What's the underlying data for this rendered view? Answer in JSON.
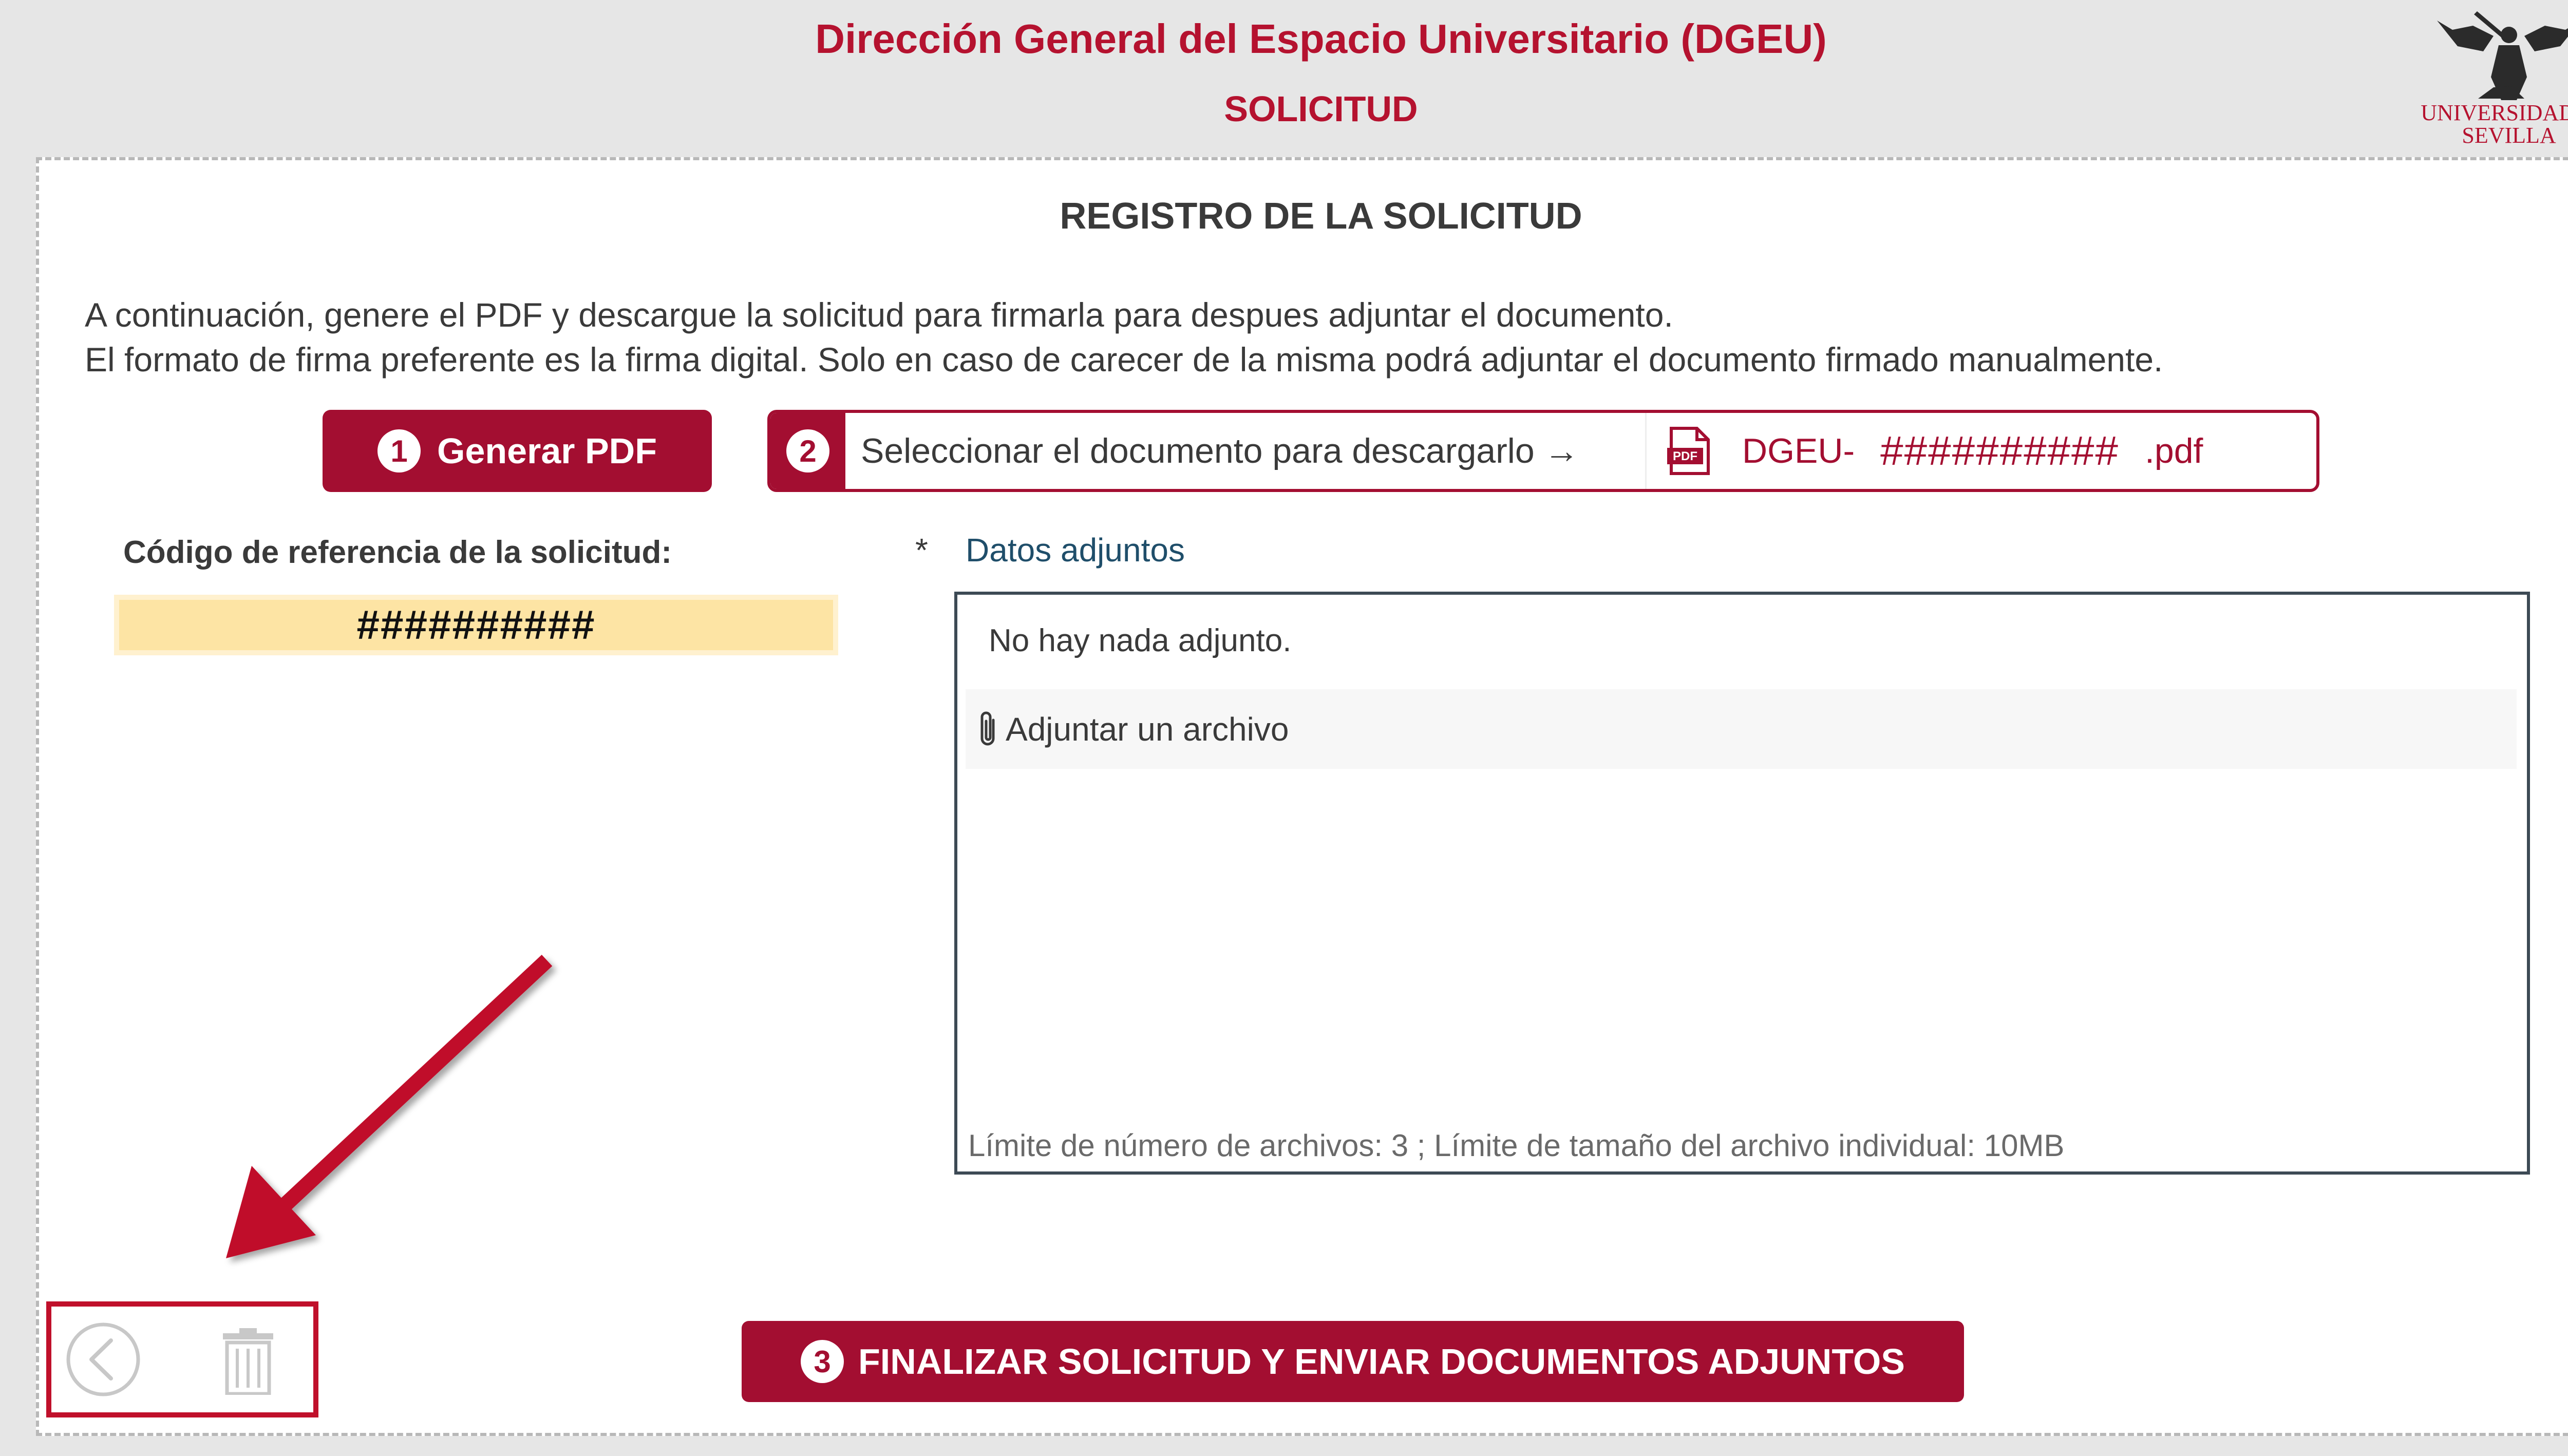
{
  "header": {
    "title": "Dirección General del Espacio Universitario (DGEU)",
    "subtitle": "SOLICITUD",
    "logo_text": "UNIVERSIDAD D SEVILLA"
  },
  "section": {
    "title": "REGISTRO DE LA SOLICITUD",
    "instructions": [
      "A continuación, genere el PDF y descargue la solicitud para firmarla para despues adjuntar el documento.",
      "El formato de firma preferente es la firma digital. Solo en caso de carecer de la misma podrá adjuntar el documento firmado manualmente."
    ]
  },
  "actions": {
    "generate_pdf": {
      "number": "1",
      "label": "Generar PDF"
    },
    "download": {
      "number": "2",
      "label": "Seleccionar el documento para descargarlo →",
      "file_prefix": "DGEU-",
      "file_code": "##########",
      "file_ext": ".pdf"
    },
    "finalize": {
      "number": "3",
      "label": "FINALIZAR SOLICITUD Y ENVIAR DOCUMENTOS ADJUNTOS"
    }
  },
  "reference": {
    "label": "Código de referencia de la solicitud:",
    "value": "##########"
  },
  "attachments": {
    "required_mark": "*",
    "label": "Datos adjuntos",
    "empty_text": "No hay nada adjunto.",
    "add_label": "Adjuntar un archivo",
    "limits": "Límite de número de archivos: 3 ; Límite de tamaño del archivo individual: 10MB"
  },
  "colors": {
    "brand": "#a30e31",
    "highlight": "#c0102b",
    "reference_bg": "#fde4a4"
  },
  "icons": {
    "back": "chevron-left-circle-icon",
    "delete": "trash-icon",
    "pdf": "pdf-file-icon",
    "attach": "paperclip-icon"
  }
}
